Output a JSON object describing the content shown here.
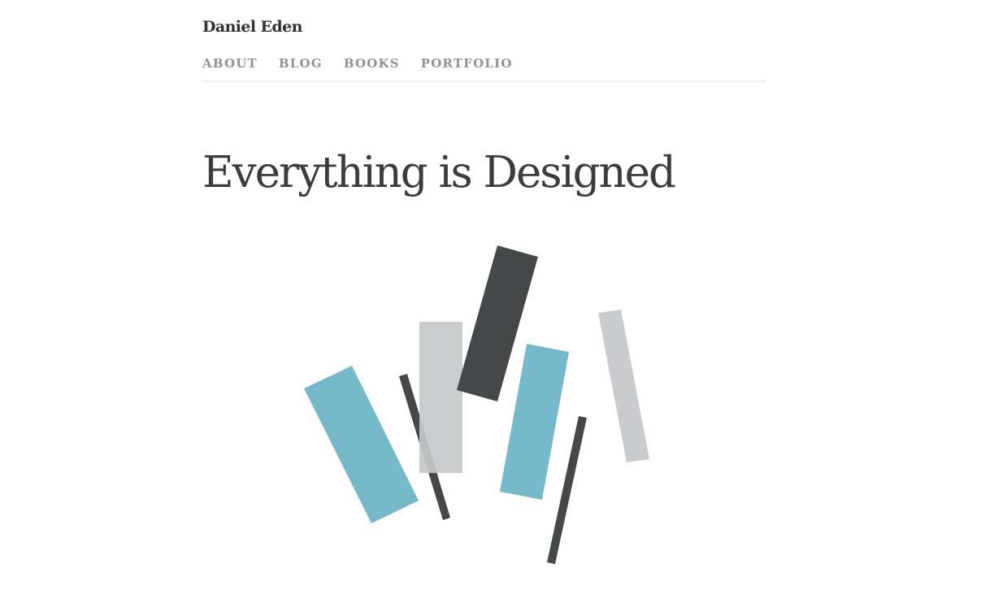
{
  "site": {
    "title": "Daniel Eden"
  },
  "nav": {
    "items": [
      {
        "label": "ABOUT"
      },
      {
        "label": "BLOG"
      },
      {
        "label": "BOOKS"
      },
      {
        "label": "PORTFOLIO"
      }
    ]
  },
  "hero": {
    "title": "Everything is Designed"
  },
  "colors": {
    "dark": "#454849",
    "blue": "#76b9cb",
    "light_gray": "#c9cccd"
  }
}
